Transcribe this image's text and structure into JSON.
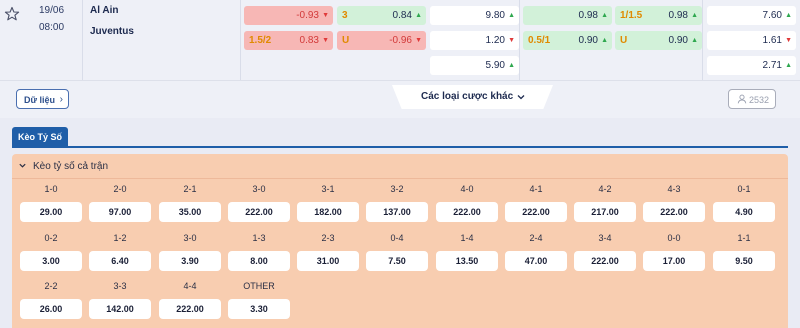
{
  "match": {
    "date": "19/06",
    "time": "08:00",
    "home": "Al Ain",
    "away": "Juventus"
  },
  "odds": {
    "c1r1": {
      "label": "",
      "value": "-0.93",
      "arrow": "▼"
    },
    "c1r2": {
      "label": "1.5/2",
      "value": "0.83",
      "arrow": "▼"
    },
    "c2r1": {
      "label": "3",
      "value": "0.84",
      "arrow": "▲"
    },
    "c2r2": {
      "label": "U",
      "value": "-0.96",
      "arrow": "▼"
    },
    "c3r1": {
      "label": "",
      "value": "9.80",
      "arrow": "▲"
    },
    "c3r2": {
      "label": "",
      "value": "1.20",
      "arrow": "▼"
    },
    "c3r3": {
      "label": "",
      "value": "5.90",
      "arrow": "▲"
    },
    "c4r1": {
      "label": "",
      "value": "0.98",
      "arrow": "▲"
    },
    "c4r2": {
      "label": "0.5/1",
      "value": "0.90",
      "arrow": "▲"
    },
    "c5r1": {
      "label": "1/1.5",
      "value": "0.98",
      "arrow": "▲"
    },
    "c5r2": {
      "label": "U",
      "value": "0.90",
      "arrow": "▲"
    },
    "c6r1": {
      "label": "",
      "value": "7.60",
      "arrow": "▲"
    },
    "c6r2": {
      "label": "",
      "value": "1.61",
      "arrow": "▼"
    },
    "c6r3": {
      "label": "",
      "value": "2.71",
      "arrow": "▲"
    }
  },
  "actions": {
    "data_button": "Dữ liệu",
    "more_bets": "Các loại cược khác",
    "bettors_count": "2532"
  },
  "tabs": {
    "active": "Kèo Tỷ Số"
  },
  "correct_score": {
    "title": "Kèo tỷ số cả trận",
    "scores": [
      {
        "score": "1-0",
        "odds": "29.00"
      },
      {
        "score": "2-0",
        "odds": "97.00"
      },
      {
        "score": "2-1",
        "odds": "35.00"
      },
      {
        "score": "3-0",
        "odds": "222.00"
      },
      {
        "score": "3-1",
        "odds": "182.00"
      },
      {
        "score": "3-2",
        "odds": "137.00"
      },
      {
        "score": "4-0",
        "odds": "222.00"
      },
      {
        "score": "4-1",
        "odds": "222.00"
      },
      {
        "score": "4-2",
        "odds": "217.00"
      },
      {
        "score": "4-3",
        "odds": "222.00"
      },
      {
        "score": "0-1",
        "odds": "4.90"
      },
      {
        "score": "0-2",
        "odds": "3.00"
      },
      {
        "score": "1-2",
        "odds": "6.40"
      },
      {
        "score": "3-0",
        "odds": "3.90"
      },
      {
        "score": "1-3",
        "odds": "8.00"
      },
      {
        "score": "2-3",
        "odds": "31.00"
      },
      {
        "score": "0-4",
        "odds": "7.50"
      },
      {
        "score": "1-4",
        "odds": "13.50"
      },
      {
        "score": "2-4",
        "odds": "47.00"
      },
      {
        "score": "3-4",
        "odds": "222.00"
      },
      {
        "score": "0-0",
        "odds": "17.00"
      },
      {
        "score": "1-1",
        "odds": "9.50"
      },
      {
        "score": "2-2",
        "odds": "26.00"
      },
      {
        "score": "3-3",
        "odds": "142.00"
      },
      {
        "score": "4-4",
        "odds": "222.00"
      },
      {
        "score": "OTHER",
        "odds": "3.30"
      }
    ]
  },
  "colors": {
    "accent": "#1f5ea8",
    "panel": "#f8cdb0",
    "down_cell": "#f7b7b5",
    "up_cell": "#d2f1d9",
    "line_label": "#e08a00"
  },
  "icons": [
    "star-icon",
    "chevron-right-icon",
    "chevron-down-icon",
    "user-icon",
    "arrow-up-icon",
    "arrow-down-icon"
  ]
}
